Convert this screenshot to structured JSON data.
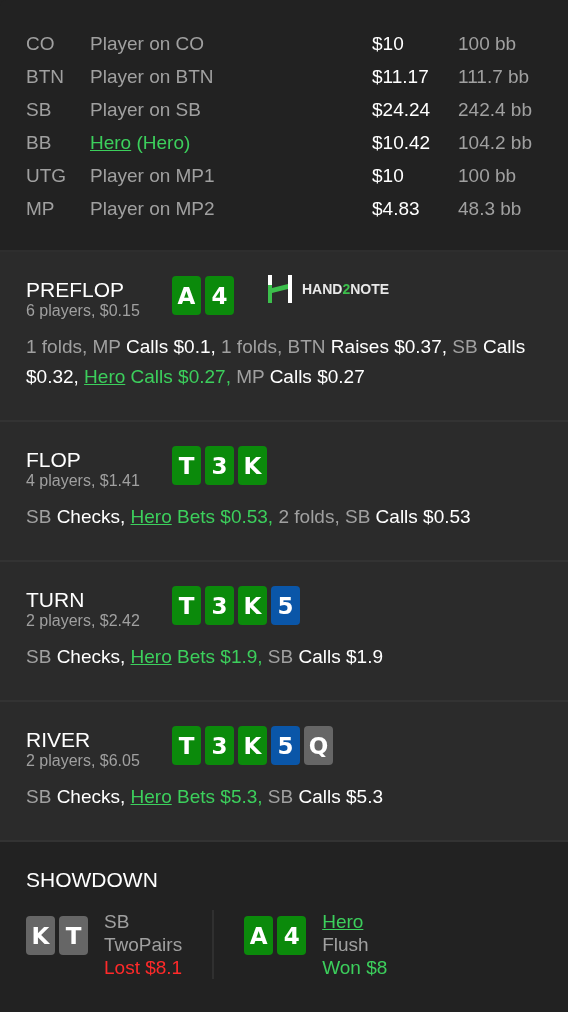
{
  "players": [
    {
      "position": "CO",
      "kind": "player",
      "name": "Player on CO",
      "stack": "$10",
      "bb": "100 bb"
    },
    {
      "position": "BTN",
      "kind": "player",
      "name": "Player on BTN",
      "stack": "$11.17",
      "bb": "111.7 bb"
    },
    {
      "position": "SB",
      "kind": "player",
      "name": "Player on SB",
      "stack": "$24.24",
      "bb": "242.4 bb"
    },
    {
      "position": "BB",
      "kind": "hero",
      "name": "Hero",
      "note": "(Hero)",
      "stack": "$10.42",
      "bb": "104.2 bb"
    },
    {
      "position": "UTG",
      "kind": "player",
      "name": "Player on MP1",
      "stack": "$10",
      "bb": "100 bb"
    },
    {
      "position": "MP",
      "kind": "player",
      "name": "Player on MP2",
      "stack": "$4.83",
      "bb": "48.3 bb"
    }
  ],
  "logo": {
    "parts": [
      "HAND",
      "2",
      "NOTE"
    ]
  },
  "streets": [
    {
      "name": "PREFLOP",
      "summary": "6 players, $0.15",
      "cards": [
        {
          "rank": "A",
          "color": "#0b8a0b"
        },
        {
          "rank": "4",
          "color": "#0b8a0b"
        }
      ],
      "actions": [
        {
          "kind": "actor",
          "text": "1 folds, MP"
        },
        {
          "kind": "act",
          "text": " Calls $0.1,"
        },
        {
          "kind": "actor",
          "text": " 1 folds, BTN"
        },
        {
          "kind": "act",
          "text": " Raises $0.37,"
        },
        {
          "kind": "actor",
          "text": " SB"
        },
        {
          "kind": "act",
          "text": " Calls $0.32,"
        },
        {
          "kind": "hero",
          "text": "Hero"
        },
        {
          "kind": "hero_act",
          "text": " Calls $0.27,"
        },
        {
          "kind": "actor",
          "text": " MP"
        },
        {
          "kind": "act",
          "text": " Calls $0.27"
        }
      ]
    },
    {
      "name": "FLOP",
      "summary": "4 players, $1.41",
      "cards": [
        {
          "rank": "T",
          "color": "#0b8a0b"
        },
        {
          "rank": "3",
          "color": "#0b8a0b"
        },
        {
          "rank": "K",
          "color": "#0b8a0b"
        }
      ],
      "actions": [
        {
          "kind": "actor",
          "text": "SB"
        },
        {
          "kind": "act",
          "text": " Checks,"
        },
        {
          "kind": "hero",
          "text": "Hero"
        },
        {
          "kind": "hero_act",
          "text": " Bets $0.53,"
        },
        {
          "kind": "actor",
          "text": " 2 folds, SB"
        },
        {
          "kind": "act",
          "text": " Calls $0.53"
        }
      ]
    },
    {
      "name": "TURN",
      "summary": "2 players, $2.42",
      "cards": [
        {
          "rank": "T",
          "color": "#0b8a0b"
        },
        {
          "rank": "3",
          "color": "#0b8a0b"
        },
        {
          "rank": "K",
          "color": "#0b8a0b"
        },
        {
          "rank": "5",
          "color": "#0a56a8"
        }
      ],
      "actions": [
        {
          "kind": "actor",
          "text": "SB"
        },
        {
          "kind": "act",
          "text": " Checks,"
        },
        {
          "kind": "hero",
          "text": "Hero"
        },
        {
          "kind": "hero_act",
          "text": " Bets $1.9,"
        },
        {
          "kind": "actor",
          "text": " SB"
        },
        {
          "kind": "act",
          "text": " Calls $1.9"
        }
      ]
    },
    {
      "name": "RIVER",
      "summary": "2 players, $6.05",
      "cards": [
        {
          "rank": "T",
          "color": "#0b8a0b"
        },
        {
          "rank": "3",
          "color": "#0b8a0b"
        },
        {
          "rank": "K",
          "color": "#0b8a0b"
        },
        {
          "rank": "5",
          "color": "#0a56a8"
        },
        {
          "rank": "Q",
          "color": "#666666"
        }
      ],
      "actions": [
        {
          "kind": "actor",
          "text": "SB"
        },
        {
          "kind": "act",
          "text": " Checks,"
        },
        {
          "kind": "hero",
          "text": "Hero"
        },
        {
          "kind": "hero_act",
          "text": " Bets $5.3,"
        },
        {
          "kind": "actor",
          "text": " SB"
        },
        {
          "kind": "act",
          "text": " Calls $5.3"
        }
      ]
    }
  ],
  "showdown": {
    "title": "SHOWDOWN",
    "hands": [
      {
        "kind": "player",
        "player": "SB",
        "hand": "TwoPairs",
        "won": false,
        "result": "Lost $8.1",
        "cards": [
          {
            "rank": "K",
            "color": "#666666"
          },
          {
            "rank": "T",
            "color": "#666666"
          }
        ]
      },
      {
        "kind": "hero",
        "player": "Hero",
        "hand": "Flush",
        "won": true,
        "result": "Won $8",
        "cards": [
          {
            "rank": "A",
            "color": "#0b8a0b"
          },
          {
            "rank": "4",
            "color": "#0b8a0b"
          }
        ]
      }
    ]
  }
}
